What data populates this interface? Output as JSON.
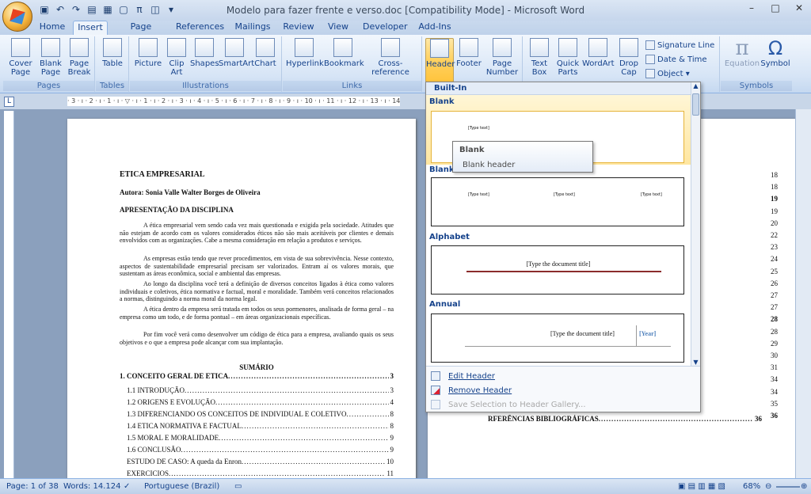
{
  "window": {
    "title": "Modelo para fazer frente e verso.doc [Compatibility Mode] - Microsoft Word"
  },
  "tabs": [
    "Home",
    "Insert",
    "Page Layout",
    "References",
    "Mailings",
    "Review",
    "View",
    "Developer",
    "Add-Ins"
  ],
  "ribbon": {
    "pages": {
      "label": "Pages",
      "cover": "Cover\nPage",
      "blank": "Blank\nPage",
      "break": "Page\nBreak"
    },
    "tables": {
      "label": "Tables",
      "table": "Table"
    },
    "illustrations": {
      "label": "Illustrations",
      "picture": "Picture",
      "clipart": "Clip\nArt",
      "shapes": "Shapes",
      "smartart": "SmartArt",
      "chart": "Chart"
    },
    "links": {
      "label": "Links",
      "hyperlink": "Hyperlink",
      "bookmark": "Bookmark",
      "crossref": "Cross-reference"
    },
    "headerfooter": {
      "header": "Header",
      "footer": "Footer",
      "pagenumber": "Page\nNumber"
    },
    "text": {
      "textbox": "Text\nBox",
      "quickparts": "Quick\nParts",
      "wordart": "WordArt",
      "dropcap": "Drop\nCap",
      "signature": "Signature Line",
      "datetime": "Date & Time",
      "object": "Object"
    },
    "symbols": {
      "label": "Symbols",
      "equation": "Equation",
      "symbol": "Symbol"
    }
  },
  "gallery": {
    "heading": "Built-In",
    "items": [
      {
        "name": "Blank",
        "placeholder": "[Type text]"
      },
      {
        "name": "Blank",
        "placeholder": "[Type text]"
      },
      {
        "name": "Alphabet",
        "placeholder": "[Type the document title]"
      },
      {
        "name": "Annual",
        "placeholder": "[Type the document title]",
        "year": "[Year]"
      }
    ],
    "commands": {
      "edit": "Edit Header",
      "remove": "Remove Header",
      "save": "Save Selection to Header Gallery..."
    }
  },
  "tooltip": {
    "title": "Blank",
    "desc": "Blank header"
  },
  "doc": {
    "title": "ETICA EMPRESARIAL",
    "author": "Autora: Sonia Valle Walter Borges de Oliveira",
    "section": "APRESENTAÇÃO DA DISCIPLINA",
    "paragraphs": [
      "A ética empresarial vem sendo cada vez mais questionada e exigida pela sociedade. Atitudes que não estejam de acordo com os valores considerados éticos não são mais aceitáveis por clientes e demais envolvidos com as organizações. Cabe a mesma consideração em relação a produtos e serviços.",
      "As empresas estão tendo que rever procedimentos, em vista de sua sobrevivência. Nesse contexto, aspectos de sustentabilidade empresarial precisam ser valorizados. Entram aí os valores morais, que sustentam as áreas econômica, social e ambiental das empresas.",
      "Ao longo da disciplina você terá a definição de diversos conceitos ligados à ética como valores individuais e coletivos, ética normativa e factual, moral e moralidade. Também verá conceitos relacionados a normas, distinguindo a norma moral da norma legal.",
      "A ética dentro da empresa será tratada em todos os seus pormenores, analisada de forma geral – na empresa como um todo, e de forma pontual – em áreas organizacionais específicas.",
      "Por fim você verá como desenvolver um código de ética para a empresa, avaliando quais os seus objetivos e o que a empresa pode alcançar com sua implantação."
    ],
    "summary": "SUMÁRIO",
    "toc": [
      {
        "label": "1. CONCEITO GERAL DE ETICA",
        "page": "3",
        "bold": true
      },
      {
        "label": "1.1 INTRODUÇÃO",
        "page": "3"
      },
      {
        "label": "1.2 ORIGENS E EVOLUÇÃO",
        "page": "4"
      },
      {
        "label": "1.3 DIFERENCIANDO OS CONCEITOS DE INDIVIDUAL E COLETIVO",
        "page": "8"
      },
      {
        "label": "1.4 ETICA NORMATIVA E FACTUAL",
        "page": "8"
      },
      {
        "label": "1.5 MORAL E MORALIDADE",
        "page": "9"
      },
      {
        "label": "1.6 CONCLUSÃO",
        "page": "9"
      },
      {
        "label": "ESTUDO DE CASO: A queda da Enron",
        "page": "10"
      },
      {
        "label": "EXERCICIOS",
        "page": "11"
      }
    ],
    "toc_right": [
      "18",
      "18",
      "19",
      "19",
      "20",
      "22",
      "23",
      "24",
      "25",
      "26",
      "27",
      "27",
      "28",
      "28",
      "29",
      "30",
      "31",
      "34",
      "34",
      "35",
      "36"
    ],
    "refs": {
      "label": "RFERÊNCIAS BIBLIOGRÁFICAS",
      "page": "36"
    }
  },
  "status": {
    "page": "Page: 1 of 38",
    "words": "Words: 14.124",
    "language": "Portuguese (Brazil)",
    "zoom": "68%"
  }
}
